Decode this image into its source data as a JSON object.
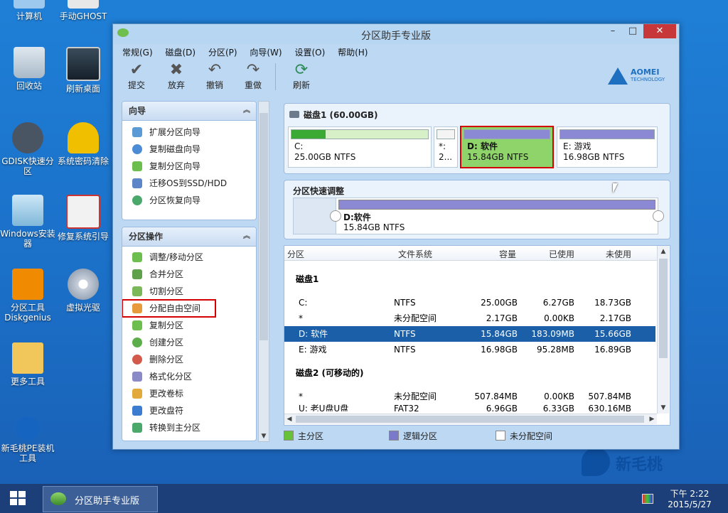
{
  "desktop": {
    "icons": [
      {
        "label": "计算机"
      },
      {
        "label": "手动GHOST"
      },
      {
        "label": "回收站"
      },
      {
        "label": "刷新桌面"
      },
      {
        "label": "GDISK快速分区"
      },
      {
        "label": "系统密码清除"
      },
      {
        "label": "Windows安装器"
      },
      {
        "label": "修复系统引导"
      },
      {
        "label": "分区工具Diskgenius"
      },
      {
        "label": "虚拟光驱"
      },
      {
        "label": "更多工具"
      },
      {
        "label": "新毛桃PE装机工具"
      }
    ],
    "watermark": "新毛桃"
  },
  "window": {
    "title": "分区助手专业版",
    "menu": [
      "常规(G)",
      "磁盘(D)",
      "分区(P)",
      "向导(W)",
      "设置(O)",
      "帮助(H)"
    ],
    "toolbar": [
      {
        "label": "提交",
        "icon": "check-icon"
      },
      {
        "label": "放弃",
        "icon": "x-icon"
      },
      {
        "label": "撤销",
        "icon": "undo-icon"
      },
      {
        "label": "重做",
        "icon": "redo-icon"
      },
      {
        "label": "刷新",
        "icon": "refresh-icon"
      }
    ],
    "brand": {
      "name": "AOMEI",
      "sub": "TECHNOLOGY"
    }
  },
  "wizard": {
    "title": "向导",
    "items": [
      "扩展分区向导",
      "复制磁盘向导",
      "复制分区向导",
      "迁移OS到SSD/HDD",
      "分区恢复向导"
    ]
  },
  "operations": {
    "title": "分区操作",
    "items": [
      "调整/移动分区",
      "合并分区",
      "切割分区",
      "分配自由空间",
      "复制分区",
      "创建分区",
      "删除分区",
      "格式化分区",
      "更改卷标",
      "更改盘符",
      "转换到主分区"
    ],
    "highlighted_index": 3
  },
  "diskmap": {
    "disk_label": "磁盘1 (60.00GB)",
    "partitions": [
      {
        "name": "C:",
        "size": "25.00GB NTFS",
        "type": "primary",
        "fill": 0.25
      },
      {
        "name": "*:",
        "size": "2...",
        "type": "unallocated"
      },
      {
        "name": "D: 软件",
        "size": "15.84GB NTFS",
        "type": "logical",
        "selected": true
      },
      {
        "name": "E: 游戏",
        "size": "16.98GB NTFS",
        "type": "logical"
      }
    ]
  },
  "quick_adjust": {
    "title": "分区快速调整",
    "name": "D:软件",
    "size": "15.84GB NTFS"
  },
  "grid": {
    "headers": [
      "分区",
      "文件系统",
      "容量",
      "已使用",
      "未使用"
    ],
    "groups": [
      {
        "title": "磁盘1",
        "rows": [
          [
            "C:",
            "NTFS",
            "25.00GB",
            "6.27GB",
            "18.73GB"
          ],
          [
            "*",
            "未分配空间",
            "2.17GB",
            "0.00KB",
            "2.17GB"
          ],
          [
            "D: 软件",
            "NTFS",
            "15.84GB",
            "183.09MB",
            "15.66GB"
          ],
          [
            "E: 游戏",
            "NTFS",
            "16.98GB",
            "95.28MB",
            "16.89GB"
          ]
        ],
        "selected_row": 2
      },
      {
        "title": "磁盘2 (可移动的)",
        "rows": [
          [
            "*",
            "未分配空间",
            "507.84MB",
            "0.00KB",
            "507.84MB"
          ],
          [
            "U: 老U盘U盘",
            "FAT32",
            "6.96GB",
            "6.33GB",
            "630.16MB"
          ]
        ]
      }
    ]
  },
  "legend": [
    {
      "label": "主分区",
      "color": "#67c23a"
    },
    {
      "label": "逻辑分区",
      "color": "#7b79c9"
    },
    {
      "label": "未分配空间",
      "color": "#ffffff"
    }
  ],
  "taskbar": {
    "app_label": "分区助手专业版",
    "time": "下午 2:22",
    "date": "2015/5/27"
  },
  "colors": {
    "accent": "#1f7fd6",
    "selected_row": "#1b5fa8",
    "highlight_border": "#d40000"
  }
}
